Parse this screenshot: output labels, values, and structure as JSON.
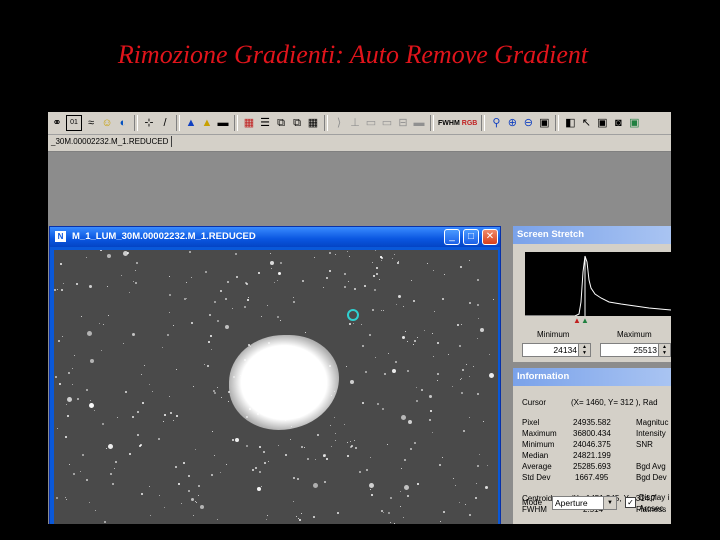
{
  "slide_title": "Rimozione Gradienti: Auto Remove Gradient",
  "toolbar": {
    "icons": [
      "link-icon",
      "counter-icon",
      "sigma-icon",
      "smiley-icon",
      "globe-icon",
      "dither-icon",
      "pencil-icon",
      "triangle-blue-icon",
      "triangle-yellow-icon",
      "ruler-icon",
      "color-grid-icon",
      "stack-icon",
      "frame-icon",
      "frame-chain-icon",
      "grid-icon",
      "stretch-icon",
      "align-icon",
      "bar-icon",
      "bar-alt-icon",
      "compare-icon",
      "monitor-icon",
      "search-icon",
      "zoom-in-icon",
      "zoom-out-icon",
      "fit-icon",
      "flip-icon",
      "pointer-icon",
      "image-icon",
      "camera-icon",
      "picture-icon"
    ],
    "fwhm_label": "FWHM",
    "rgb_label": "RGB"
  },
  "file_tab": "_30M.00002232.M_1.REDUCED",
  "image_window": {
    "title": "M_1_LUM_30M.00002232.M_1.REDUCED",
    "min_glyph": "_",
    "max_glyph": "□",
    "close_glyph": "✕"
  },
  "screen_stretch": {
    "title": "Screen Stretch",
    "minimum_label": "Minimum",
    "maximum_label": "Maximum",
    "minimum_value": "24134",
    "maximum_value": "25513"
  },
  "information": {
    "title": "Information",
    "cursor_label": "Cursor",
    "cursor_value": "(X= 1460, Y=  312 ), Rad",
    "rows": [
      {
        "label": "Pixel",
        "value": "24935.582",
        "right": "Magnituc"
      },
      {
        "label": "Maximum",
        "value": "36800.434",
        "right": "Intensity"
      },
      {
        "label": "Minimum",
        "value": "24046.375",
        "right": "SNR"
      },
      {
        "label": "Median",
        "value": "24821.199",
        "right": ""
      },
      {
        "label": "Average",
        "value": "25285.693",
        "right": "Bgd Avg"
      },
      {
        "label": "Std Dev",
        "value": "1667.495",
        "right": "Bgd Dev"
      }
    ],
    "centroid_label": "Centroid",
    "centroid_value": "(X= 1451.345, Y=  314.7",
    "fwhm_label": "FWHM",
    "fwhm_value": "2.514\"",
    "flatness_label": "Flatness",
    "mode_label": "Mode",
    "mode_value": "Aperture",
    "display_label": "Display i",
    "arcsec_label": "Arcsec"
  }
}
